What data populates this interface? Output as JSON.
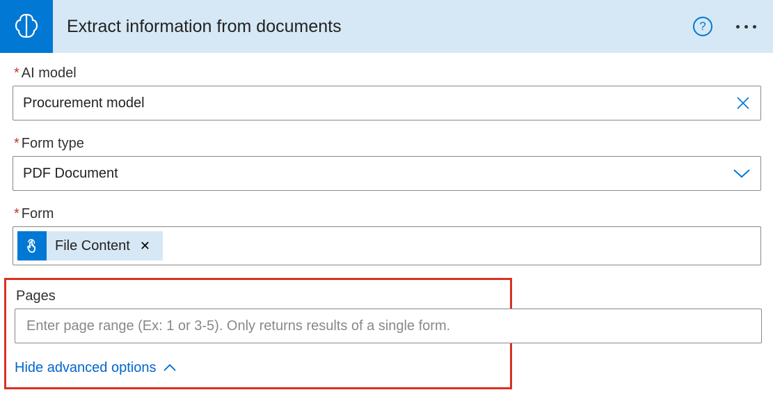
{
  "header": {
    "title": "Extract information from documents"
  },
  "fields": {
    "ai_model": {
      "label": "AI model",
      "value": "Procurement model"
    },
    "form_type": {
      "label": "Form type",
      "value": "PDF Document"
    },
    "form": {
      "label": "Form",
      "token": "File Content"
    },
    "pages": {
      "label": "Pages",
      "placeholder": "Enter page range (Ex: 1 or 3-5). Only returns results of a single form."
    }
  },
  "links": {
    "hide_advanced": "Hide advanced options"
  }
}
